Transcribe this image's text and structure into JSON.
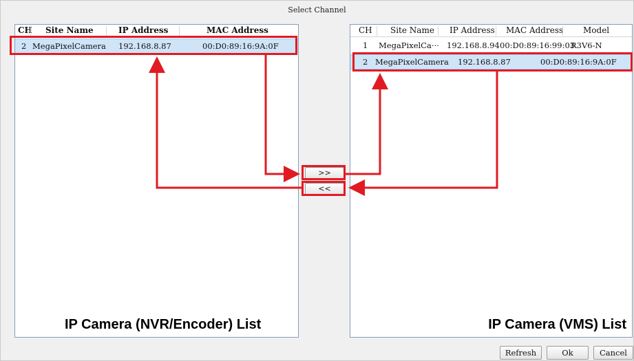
{
  "dialog": {
    "title": "Select Channel"
  },
  "left_panel": {
    "caption": "IP Camera (NVR/Encoder) List",
    "columns": [
      "CH",
      "Site Name",
      "IP Address",
      "MAC Address"
    ],
    "rows": [
      {
        "ch": "2",
        "site_name": "MegaPixelCamera",
        "ip": "192.168.8.87",
        "mac": "00:D0:89:16:9A:0F",
        "selected": true
      }
    ]
  },
  "right_panel": {
    "caption": "IP Camera (VMS) List",
    "columns": [
      "CH",
      "Site Name",
      "IP Address",
      "MAC Address",
      "Model"
    ],
    "rows": [
      {
        "ch": "1",
        "site_name": "MegaPixelCa···",
        "ip": "192.168.8.94",
        "mac": "00:D0:89:16:99:03",
        "model": "R3V6-N",
        "selected": false
      },
      {
        "ch": "2",
        "site_name": "MegaPixelCamera",
        "ip": "192.168.8.87",
        "mac": "00:D0:89:16:9A:0F",
        "model": "",
        "selected": true
      }
    ]
  },
  "move_buttons": {
    "add": ">>",
    "remove": "<<"
  },
  "footer_buttons": {
    "refresh": "Refresh",
    "ok": "Ok",
    "cancel": "Cancel"
  },
  "colors": {
    "annotation": "#e11b22",
    "selection": "#cfe4f7",
    "panel_border": "#8a9db8"
  }
}
